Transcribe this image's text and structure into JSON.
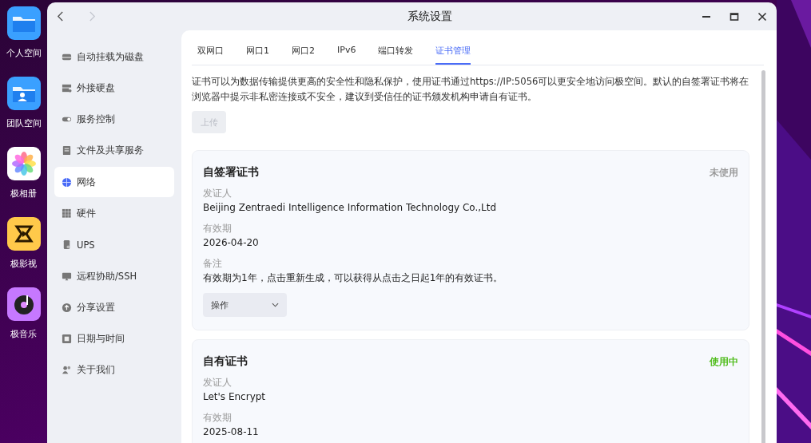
{
  "desktop_icons": [
    {
      "label": "个人空间"
    },
    {
      "label": "团队空间"
    },
    {
      "label": "极相册"
    },
    {
      "label": "极影视"
    },
    {
      "label": "极音乐"
    }
  ],
  "window": {
    "title": "系统设置",
    "back_disabled": false,
    "forward_disabled": true
  },
  "sidebar": {
    "items": [
      {
        "label": "自动挂载为磁盘",
        "selected": false
      },
      {
        "label": "外接硬盘",
        "selected": false
      },
      {
        "label": "服务控制",
        "selected": false
      },
      {
        "label": "文件及共享服务",
        "selected": false
      },
      {
        "label": "网络",
        "selected": true
      },
      {
        "label": "硬件",
        "selected": false
      },
      {
        "label": "UPS",
        "selected": false
      },
      {
        "label": "远程协助/SSH",
        "selected": false
      },
      {
        "label": "分享设置",
        "selected": false
      },
      {
        "label": "日期与时间",
        "selected": false
      },
      {
        "label": "关于我们",
        "selected": false
      }
    ]
  },
  "tabs": [
    {
      "label": "双网口",
      "selected": false
    },
    {
      "label": "网口1",
      "selected": false
    },
    {
      "label": "网口2",
      "selected": false
    },
    {
      "label": "IPv6",
      "selected": false
    },
    {
      "label": "端口转发",
      "selected": false
    },
    {
      "label": "证书管理",
      "selected": true
    }
  ],
  "description": "证书可以为数据传输提供更高的安全性和隐私保护，使用证书通过https://IP:5056可以更安全地访问极空间。默认的自签署证书将在浏览器中提示非私密连接或不安全，建议到受信任的证书颁发机构申请自有证书。",
  "upload_button": {
    "label": "上传",
    "disabled": true
  },
  "certificates": [
    {
      "title": "自签署证书",
      "status": "未使用",
      "in_use": false,
      "fields": [
        {
          "label": "发证人",
          "value": "Beijing Zentraedi Intelligence Information Technology Co.,Ltd"
        },
        {
          "label": "有效期",
          "value": "2026-04-20"
        },
        {
          "label": "备注",
          "value": "有效期为1年，点击重新生成，可以获得从点击之日起1年的有效证书。"
        }
      ],
      "action": "操作"
    },
    {
      "title": "自有证书",
      "status": "使用中",
      "in_use": true,
      "fields": [
        {
          "label": "发证人",
          "value": "Let's Encrypt"
        },
        {
          "label": "有效期",
          "value": "2025-08-11"
        }
      ]
    }
  ]
}
